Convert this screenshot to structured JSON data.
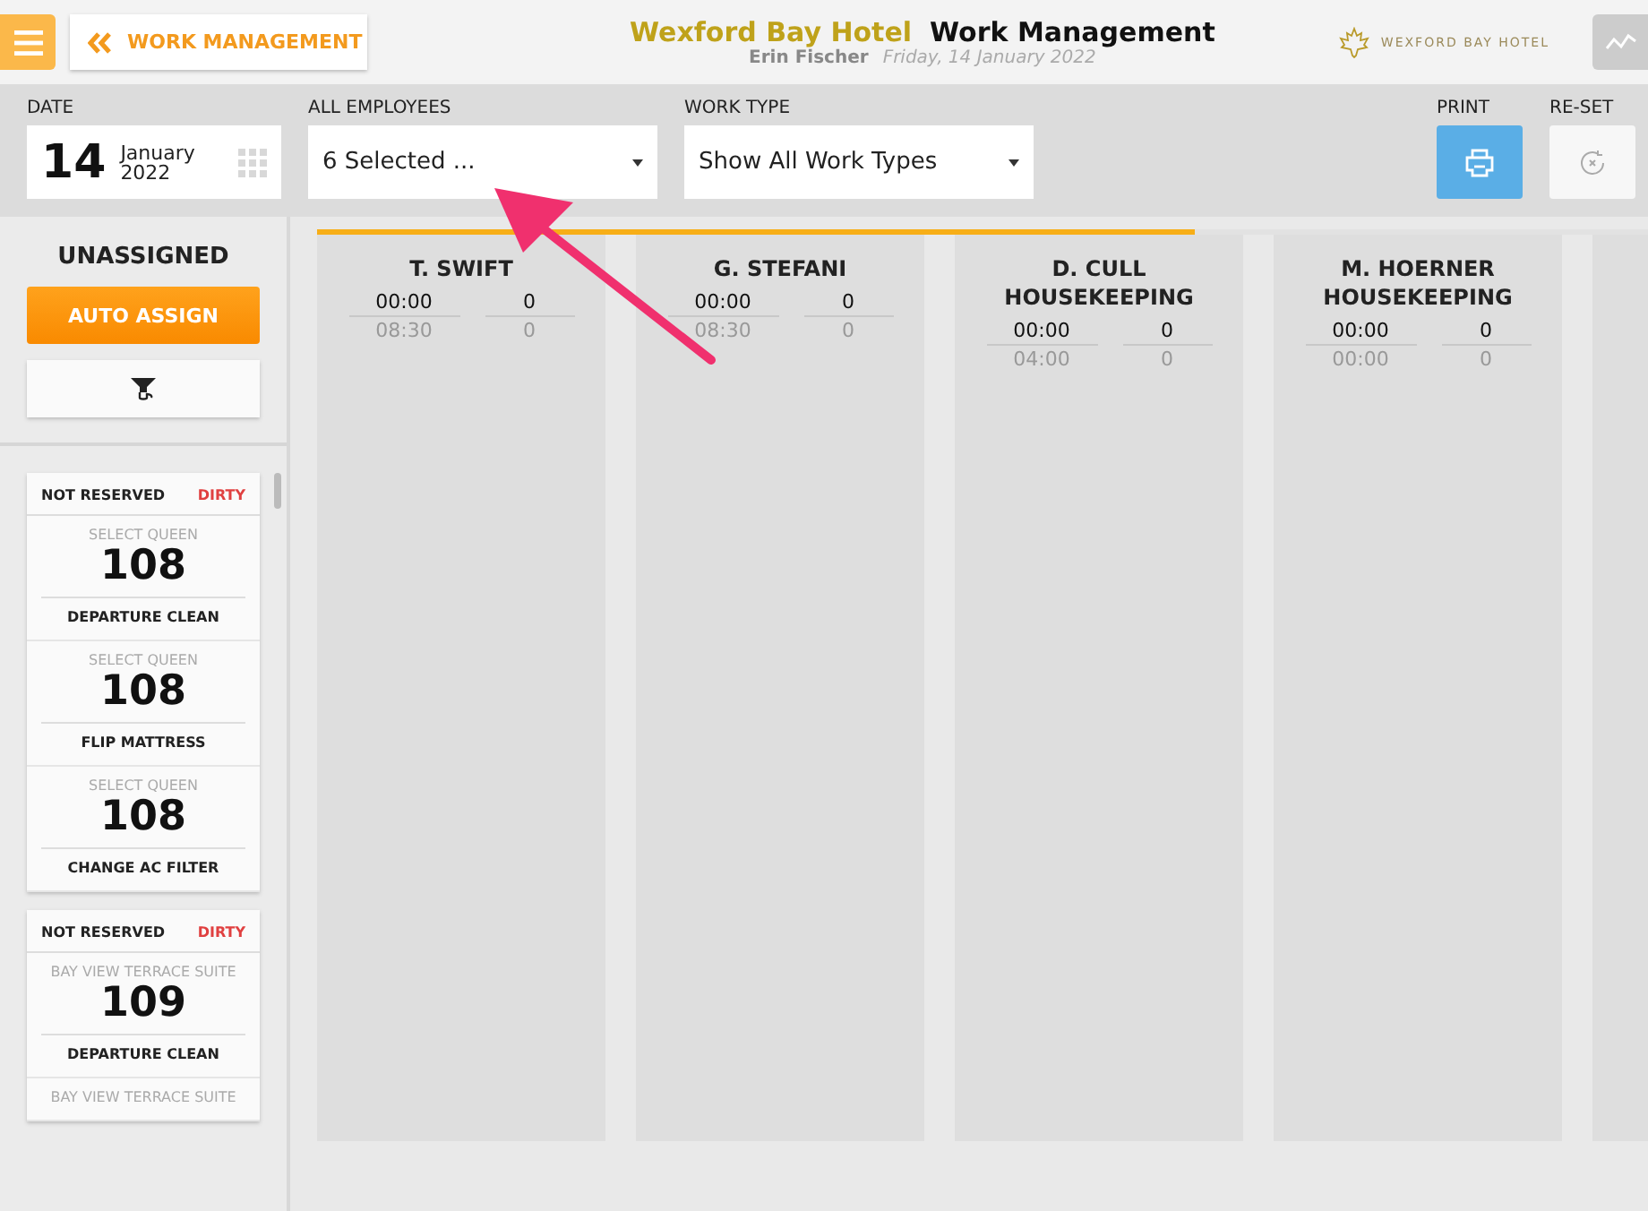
{
  "header": {
    "back_label": "WORK MANAGEMENT",
    "hotel_name": "Wexford Bay Hotel",
    "title": "Work Management",
    "user": "Erin Fischer",
    "date": "Friday, 14 January 2022",
    "logo_text": "WEXFORD BAY HOTEL"
  },
  "filters": {
    "date_label": "DATE",
    "day": "14",
    "month": "January",
    "year": "2022",
    "employees_label": "ALL EMPLOYEES",
    "employees_value": "6 Selected ...",
    "work_type_label": "WORK TYPE",
    "work_type_value": "Show All Work Types",
    "print_label": "PRINT",
    "reset_label": "RE-SET"
  },
  "unassigned": {
    "title": "UNASSIGNED",
    "auto_assign": "AUTO ASSIGN",
    "groups": [
      {
        "reservation": "NOT RESERVED",
        "status": "DIRTY",
        "tasks": [
          {
            "room_type": "SELECT QUEEN",
            "room": "108",
            "task": "DEPARTURE CLEAN"
          },
          {
            "room_type": "SELECT QUEEN",
            "room": "108",
            "task": "FLIP MATTRESS"
          },
          {
            "room_type": "SELECT QUEEN",
            "room": "108",
            "task": "CHANGE AC FILTER"
          }
        ]
      },
      {
        "reservation": "NOT RESERVED",
        "status": "DIRTY",
        "tasks": [
          {
            "room_type": "BAY VIEW TERRACE SUITE",
            "room": "109",
            "task": "DEPARTURE CLEAN"
          },
          {
            "room_type": "BAY VIEW TERRACE SUITE"
          }
        ]
      }
    ]
  },
  "loading_bar": {
    "level": 0.66
  },
  "employees": [
    {
      "name": "T. SWIFT",
      "time": "00:00",
      "count": "0",
      "planned_time": "08:30",
      "planned_count": "0"
    },
    {
      "name": "G. STEFANI",
      "time": "00:00",
      "count": "0",
      "planned_time": "08:30",
      "planned_count": "0"
    },
    {
      "name": "D. CULL HOUSEKEEPING",
      "time": "00:00",
      "count": "0",
      "planned_time": "04:00",
      "planned_count": "0"
    },
    {
      "name": "M. HOERNER HOUSEKEEPING",
      "time": "00:00",
      "count": "0",
      "planned_time": "00:00",
      "planned_count": "0"
    }
  ]
}
